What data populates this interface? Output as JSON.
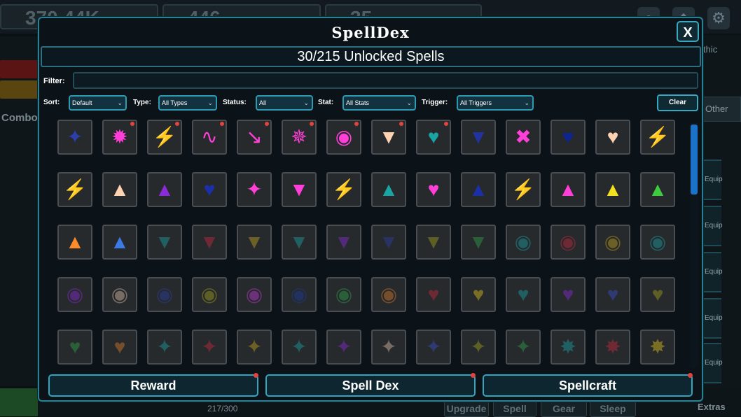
{
  "background": {
    "stats": [
      "370.44K",
      "446",
      "35"
    ],
    "left_label": "Combo",
    "right_labels": [
      "thic",
      "Other"
    ],
    "right_items": [
      "Equip",
      "Equip",
      "Equip",
      "Equip",
      "Equip"
    ],
    "bottom_count": "217/300",
    "bottom_tabs": [
      "Upgrade",
      "Spell",
      "Gear",
      "Sleep"
    ],
    "extras": "Extras"
  },
  "modal": {
    "title": "SpellDex",
    "close_label": "X",
    "unlocked": "30/215 Unlocked Spells",
    "filter_label": "Filter:",
    "filter_value": "",
    "controls": {
      "sort_label": "Sort:",
      "sort_value": "Default",
      "type_label": "Type:",
      "type_value": "All Types",
      "status_label": "Status:",
      "status_value": "All",
      "stat_label": "Stat:",
      "stat_value": "All Stats",
      "trigger_label": "Trigger:",
      "trigger_value": "All Triggers",
      "clear_label": "Clear"
    },
    "buttons": [
      "Reward",
      "Spell Dex",
      "Spellcraft"
    ]
  },
  "spells": [
    {
      "icon": "strength-icon",
      "color": "#2a3fa8",
      "dot": false,
      "dim": false
    },
    {
      "icon": "burst-icon",
      "color": "#ff3fd8",
      "dot": true,
      "dim": false
    },
    {
      "icon": "bolt-icon",
      "color": "#f2d21c",
      "dot": true,
      "dim": false
    },
    {
      "icon": "swirl-icon",
      "color": "#ff3fd8",
      "dot": true,
      "dim": false
    },
    {
      "icon": "arrow-icon",
      "color": "#ff3fd8",
      "dot": true,
      "dim": false
    },
    {
      "icon": "star-burst-icon",
      "color": "#ff3fd8",
      "dot": true,
      "dim": false
    },
    {
      "icon": "eye-icon",
      "color": "#ff3fd8",
      "dot": true,
      "dim": false
    },
    {
      "icon": "drip-icon",
      "color": "#ffd2b0",
      "dot": true,
      "dim": false
    },
    {
      "icon": "heart-minus-icon",
      "color": "#1aa3a3",
      "dot": true,
      "dim": false
    },
    {
      "icon": "drip-icon",
      "color": "#2233a0",
      "dot": false,
      "dim": false
    },
    {
      "icon": "cross-icon",
      "color": "#ff3fd8",
      "dot": false,
      "dim": false
    },
    {
      "icon": "heart-icon",
      "color": "#0e2590",
      "dot": false,
      "dim": false
    },
    {
      "icon": "heart-minus-icon",
      "color": "#ffd2b0",
      "dot": false,
      "dim": false
    },
    {
      "icon": "bolt-icon",
      "color": "#ffd2b0",
      "dot": false,
      "dim": false
    },
    {
      "icon": "bolt-icon",
      "color": "#1aa3a3",
      "dot": false,
      "dim": false
    },
    {
      "icon": "chevron-up-icon",
      "color": "#ffd2b0",
      "dot": false,
      "dim": false
    },
    {
      "icon": "chevron-up-icon",
      "color": "#8a2bd8",
      "dot": false,
      "dim": false
    },
    {
      "icon": "heart-minus-icon",
      "color": "#1a2fa8",
      "dot": false,
      "dim": false
    },
    {
      "icon": "strength-icon",
      "color": "#ff3fd8",
      "dot": false,
      "dim": false
    },
    {
      "icon": "drip-icon",
      "color": "#ff3fd8",
      "dot": false,
      "dim": false
    },
    {
      "icon": "bolt-icon",
      "color": "#2a3fa8",
      "dot": false,
      "dim": false
    },
    {
      "icon": "chevron-up-icon",
      "color": "#1aa3a3",
      "dot": false,
      "dim": false
    },
    {
      "icon": "heart-minus-icon",
      "color": "#ff3fd8",
      "dot": false,
      "dim": false
    },
    {
      "icon": "chevron-up-icon",
      "color": "#1a2fa8",
      "dot": false,
      "dim": false
    },
    {
      "icon": "bolt-icon",
      "color": "#ff3fd8",
      "dot": false,
      "dim": false
    },
    {
      "icon": "chevron-up-icon",
      "color": "#ff3fd8",
      "dot": false,
      "dim": false
    },
    {
      "icon": "chevron-up-icon",
      "color": "#f2e11c",
      "dot": false,
      "dim": false
    },
    {
      "icon": "chevron-up-icon",
      "color": "#3ecb3e",
      "dot": false,
      "dim": false
    },
    {
      "icon": "chevron-up-icon",
      "color": "#ff8a2a",
      "dot": false,
      "dim": false
    },
    {
      "icon": "chevron-up-icon",
      "color": "#3a7be8",
      "dot": false,
      "dim": false
    },
    {
      "icon": "drip-icon",
      "color": "#1aa3a3",
      "dot": false,
      "dim": true
    },
    {
      "icon": "drip-icon",
      "color": "#c8283e",
      "dot": false,
      "dim": true
    },
    {
      "icon": "drip-icon",
      "color": "#c0a21a",
      "dot": false,
      "dim": true
    },
    {
      "icon": "drip-icon",
      "color": "#1aa3a3",
      "dot": false,
      "dim": true
    },
    {
      "icon": "drip-icon",
      "color": "#8a2bd8",
      "dot": false,
      "dim": true
    },
    {
      "icon": "drip-icon",
      "color": "#2a3fa8",
      "dot": false,
      "dim": true
    },
    {
      "icon": "drip-icon",
      "color": "#a0a01a",
      "dot": false,
      "dim": true
    },
    {
      "icon": "drip-icon",
      "color": "#2ea04a",
      "dot": false,
      "dim": true
    },
    {
      "icon": "eye-icon",
      "color": "#1aa3a3",
      "dot": false,
      "dim": true
    },
    {
      "icon": "eye-icon",
      "color": "#c8283e",
      "dot": false,
      "dim": true
    },
    {
      "icon": "eye-icon",
      "color": "#c0a21a",
      "dot": false,
      "dim": true
    },
    {
      "icon": "eye-icon",
      "color": "#1aa3a3",
      "dot": false,
      "dim": true
    },
    {
      "icon": "eye-icon",
      "color": "#8a2bd8",
      "dot": false,
      "dim": true
    },
    {
      "icon": "eye-icon",
      "color": "#d8c0a8",
      "dot": false,
      "dim": true
    },
    {
      "icon": "eye-icon",
      "color": "#2a3fa8",
      "dot": false,
      "dim": true
    },
    {
      "icon": "eye-icon",
      "color": "#a0a01a",
      "dot": false,
      "dim": true
    },
    {
      "icon": "eye-icon",
      "color": "#c03ad8",
      "dot": false,
      "dim": true
    },
    {
      "icon": "eye-icon",
      "color": "#1a3aa0",
      "dot": false,
      "dim": true
    },
    {
      "icon": "eye-icon",
      "color": "#2ea04a",
      "dot": false,
      "dim": true
    },
    {
      "icon": "eye-icon",
      "color": "#d87a2a",
      "dot": false,
      "dim": true
    },
    {
      "icon": "heart-minus-icon",
      "color": "#c8283e",
      "dot": false,
      "dim": true
    },
    {
      "icon": "heart-minus-icon",
      "color": "#e0c01a",
      "dot": false,
      "dim": true
    },
    {
      "icon": "heart-minus-icon",
      "color": "#1aa3a3",
      "dot": false,
      "dim": true
    },
    {
      "icon": "heart-minus-icon",
      "color": "#8a2bd8",
      "dot": false,
      "dim": true
    },
    {
      "icon": "heart-minus-icon",
      "color": "#3a4fc8",
      "dot": false,
      "dim": true
    },
    {
      "icon": "heart-minus-icon",
      "color": "#a0a01a",
      "dot": false,
      "dim": true
    },
    {
      "icon": "heart-minus-icon",
      "color": "#2ea04a",
      "dot": false,
      "dim": true
    },
    {
      "icon": "heart-minus-icon",
      "color": "#d87a2a",
      "dot": false,
      "dim": true
    },
    {
      "icon": "strength-icon",
      "color": "#1aa3a3",
      "dot": false,
      "dim": true
    },
    {
      "icon": "strength-icon",
      "color": "#c8283e",
      "dot": false,
      "dim": true
    },
    {
      "icon": "strength-icon",
      "color": "#c0a21a",
      "dot": false,
      "dim": true
    },
    {
      "icon": "strength-icon",
      "color": "#1aa3a3",
      "dot": false,
      "dim": true
    },
    {
      "icon": "strength-icon",
      "color": "#8a2bd8",
      "dot": false,
      "dim": true
    },
    {
      "icon": "strength-icon",
      "color": "#d8c0a8",
      "dot": false,
      "dim": true
    },
    {
      "icon": "strength-icon",
      "color": "#3a4fc8",
      "dot": false,
      "dim": true
    },
    {
      "icon": "strength-icon",
      "color": "#a0a01a",
      "dot": false,
      "dim": true
    },
    {
      "icon": "strength-icon",
      "color": "#2ea04a",
      "dot": false,
      "dim": true
    },
    {
      "icon": "fist-icon",
      "color": "#1aa3a3",
      "dot": false,
      "dim": true
    },
    {
      "icon": "fist-icon",
      "color": "#c8283e",
      "dot": false,
      "dim": true
    },
    {
      "icon": "fist-icon",
      "color": "#e0c01a",
      "dot": false,
      "dim": true
    }
  ]
}
